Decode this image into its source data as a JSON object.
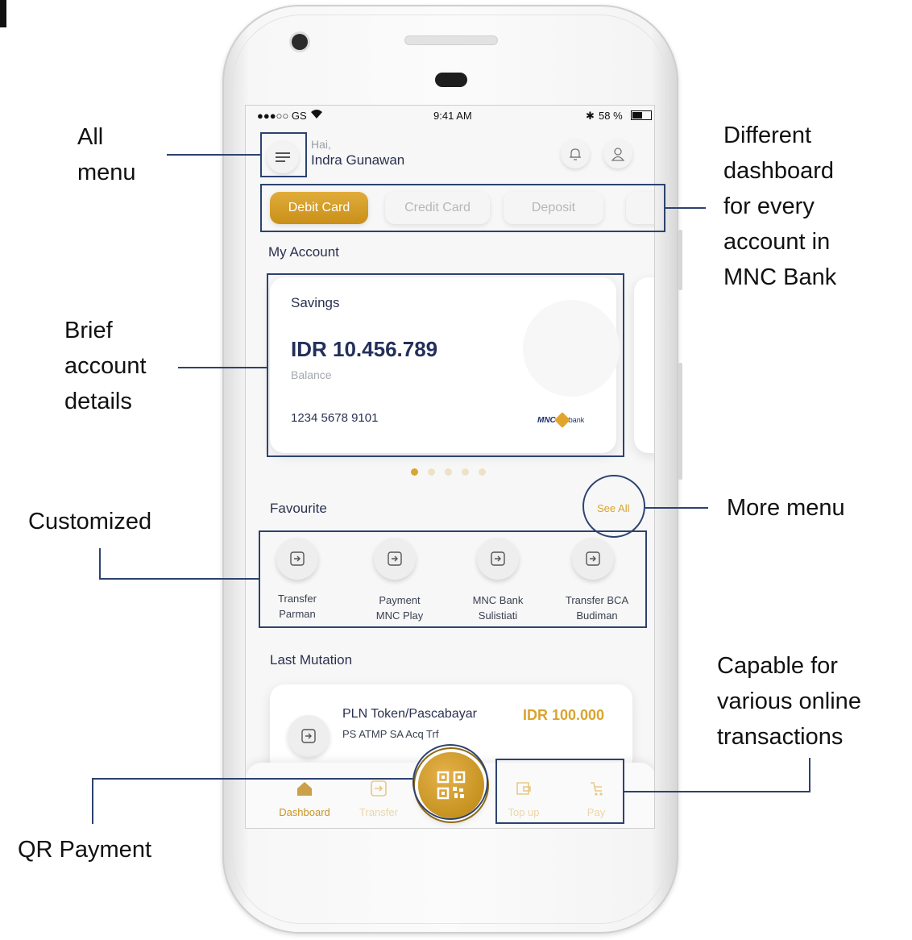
{
  "status_bar": {
    "carrier": "●●●○○ GS",
    "time": "9:41 AM",
    "battery": "58 %"
  },
  "header": {
    "greeting": "Hai,",
    "user_name": "Indra Gunawan"
  },
  "tabs": [
    {
      "label": "Debit Card",
      "active": true
    },
    {
      "label": "Credit Card",
      "active": false
    },
    {
      "label": "Deposit",
      "active": false
    }
  ],
  "my_account": {
    "title": "My Account",
    "card": {
      "type": "Savings",
      "balance": "IDR 10.456.789",
      "balance_label": "Balance",
      "account_number": "1234 5678 9101",
      "logo_text": "MNC",
      "logo_suffix": "bank"
    },
    "pagination": {
      "count": 5,
      "active_index": 0
    }
  },
  "favourite": {
    "title": "Favourite",
    "see_all": "See All",
    "items": [
      {
        "line1": "Transfer",
        "line2": "Parman"
      },
      {
        "line1": "Payment",
        "line2": "MNC Play"
      },
      {
        "line1": "MNC Bank",
        "line2": "Sulistiati"
      },
      {
        "line1": "Transfer BCA",
        "line2": "Budiman"
      }
    ]
  },
  "last_mutation": {
    "title": "Last Mutation",
    "item": {
      "title": "PLN Token/Pascabayar",
      "subtitle": "PS ATMP SA Acq Trf",
      "amount": "IDR 100.000"
    }
  },
  "bottom_nav": {
    "dashboard": "Dashboard",
    "transfer": "Transfer",
    "top_up": "Top up",
    "pay": "Pay"
  },
  "annotations": {
    "all_menu": [
      "All",
      "menu"
    ],
    "dashboard": [
      "Different",
      "dashboard",
      "for every",
      "account in",
      "MNC Bank"
    ],
    "brief": [
      "Brief",
      "account",
      "details"
    ],
    "customized": "Customized",
    "more_menu": "More menu",
    "transactions": [
      "Capable for",
      "various online",
      "transactions"
    ],
    "qr_payment": "QR Payment"
  },
  "colors": {
    "gold": "#d9a430",
    "navy": "#2a3150",
    "annotation": "#2d4270"
  }
}
